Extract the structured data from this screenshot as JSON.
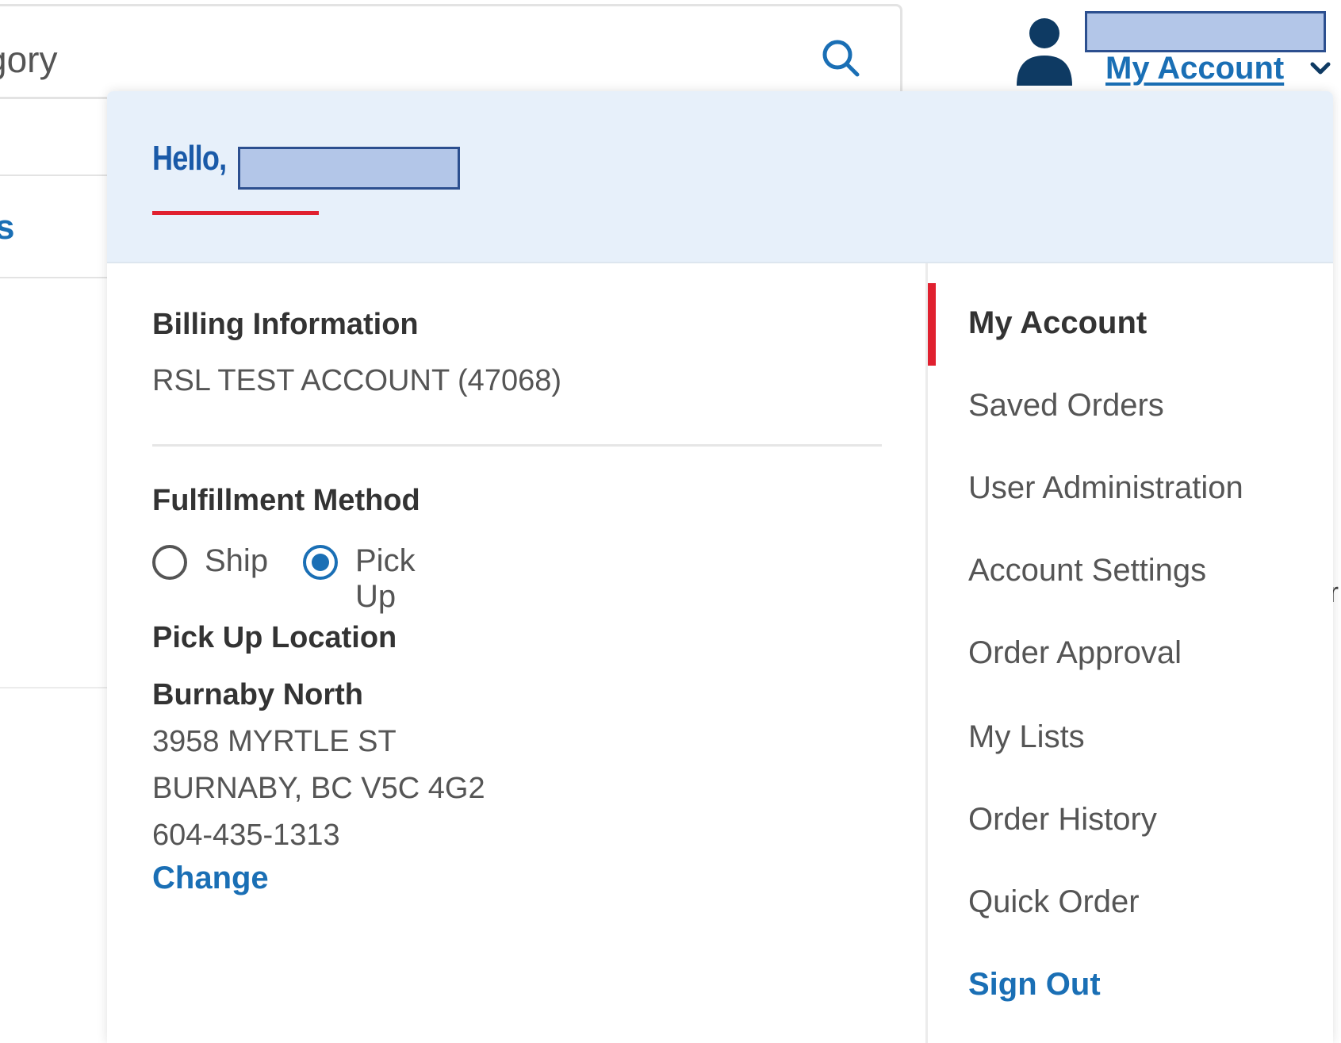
{
  "search": {
    "visible_text": "gory"
  },
  "background_fragments": {
    "left": "s",
    "right": "r"
  },
  "header": {
    "account_label": "My Account"
  },
  "panel": {
    "greeting": "Hello,",
    "billing": {
      "heading": "Billing Information",
      "account": "RSL TEST ACCOUNT (47068)"
    },
    "fulfillment": {
      "heading": "Fulfillment Method",
      "options": [
        {
          "label": "Ship",
          "selected": false
        },
        {
          "label": "Pick Up",
          "selected": true
        }
      ]
    },
    "pickup": {
      "heading": "Pick Up Location",
      "name": "Burnaby North",
      "address_line1": "3958 MYRTLE ST",
      "address_line2": "BURNABY, BC V5C 4G2",
      "phone": "604-435-1313",
      "change_label": "Change"
    },
    "menu": {
      "items": [
        "My Account",
        "Saved Orders",
        "User Administration",
        "Account Settings",
        "Order Approval",
        "My Lists",
        "Order History",
        "Quick Order"
      ],
      "active_item": "My Account",
      "sign_out": "Sign Out"
    }
  },
  "colors": {
    "accent_blue": "#1a6fb5",
    "active_red": "#e0202f",
    "header_bg": "#e7f0fa",
    "redaction_fill": "#b3c6e8"
  }
}
